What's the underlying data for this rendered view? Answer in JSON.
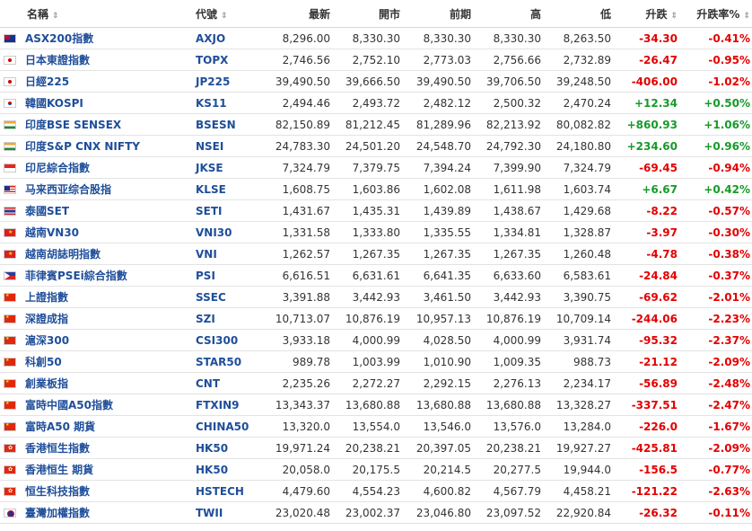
{
  "header": {
    "name": "名稱",
    "code": "代號",
    "last": "最新",
    "open": "開市",
    "prev": "前期",
    "high": "高",
    "low": "低",
    "change": "升跌",
    "change_pct": "升跌率%",
    "sort_glyph": "⇕"
  },
  "colors": {
    "link": "#1f4e9a",
    "down": "#e30000",
    "up": "#189a2a"
  },
  "rows": [
    {
      "flag": "au-flag-icon",
      "name": "ASX200指數",
      "code": "AXJO",
      "last": "8,296.00",
      "open": "8,330.30",
      "prev": "8,330.30",
      "high": "8,330.30",
      "low": "8,263.50",
      "change": "-34.30",
      "pct": "-0.41%",
      "dir": "down"
    },
    {
      "flag": "jp-flag-icon",
      "name": "日本東證指數",
      "code": "TOPX",
      "last": "2,746.56",
      "open": "2,752.10",
      "prev": "2,773.03",
      "high": "2,756.66",
      "low": "2,732.89",
      "change": "-26.47",
      "pct": "-0.95%",
      "dir": "down"
    },
    {
      "flag": "jp-flag-icon",
      "name": "日經225",
      "code": "JP225",
      "last": "39,490.50",
      "open": "39,666.50",
      "prev": "39,490.50",
      "high": "39,706.50",
      "low": "39,248.50",
      "change": "-406.00",
      "pct": "-1.02%",
      "dir": "down"
    },
    {
      "flag": "kr-flag-icon",
      "name": "韓國KOSPI",
      "code": "KS11",
      "last": "2,494.46",
      "open": "2,493.72",
      "prev": "2,482.12",
      "high": "2,500.32",
      "low": "2,470.24",
      "change": "+12.34",
      "pct": "+0.50%",
      "dir": "up"
    },
    {
      "flag": "in-flag-icon",
      "name": "印度BSE SENSEX",
      "code": "BSESN",
      "last": "82,150.89",
      "open": "81,212.45",
      "prev": "81,289.96",
      "high": "82,213.92",
      "low": "80,082.82",
      "change": "+860.93",
      "pct": "+1.06%",
      "dir": "up"
    },
    {
      "flag": "in-flag-icon",
      "name": "印度S&P CNX NIFTY",
      "code": "NSEI",
      "last": "24,783.30",
      "open": "24,501.20",
      "prev": "24,548.70",
      "high": "24,792.30",
      "low": "24,180.80",
      "change": "+234.60",
      "pct": "+0.96%",
      "dir": "up"
    },
    {
      "flag": "id-flag-icon",
      "name": "印尼綜合指數",
      "code": "JKSE",
      "last": "7,324.79",
      "open": "7,379.75",
      "prev": "7,394.24",
      "high": "7,399.90",
      "low": "7,324.79",
      "change": "-69.45",
      "pct": "-0.94%",
      "dir": "down"
    },
    {
      "flag": "my-flag-icon",
      "name": "马来西亚综合股指",
      "code": "KLSE",
      "last": "1,608.75",
      "open": "1,603.86",
      "prev": "1,602.08",
      "high": "1,611.98",
      "low": "1,603.74",
      "change": "+6.67",
      "pct": "+0.42%",
      "dir": "up"
    },
    {
      "flag": "th-flag-icon",
      "name": "泰國SET",
      "code": "SETI",
      "last": "1,431.67",
      "open": "1,435.31",
      "prev": "1,439.89",
      "high": "1,438.67",
      "low": "1,429.68",
      "change": "-8.22",
      "pct": "-0.57%",
      "dir": "down"
    },
    {
      "flag": "vn-flag-icon",
      "name": "越南VN30",
      "code": "VNI30",
      "last": "1,331.58",
      "open": "1,333.80",
      "prev": "1,335.55",
      "high": "1,334.81",
      "low": "1,328.87",
      "change": "-3.97",
      "pct": "-0.30%",
      "dir": "down"
    },
    {
      "flag": "vn-flag-icon",
      "name": "越南胡誌明指數",
      "code": "VNI",
      "last": "1,262.57",
      "open": "1,267.35",
      "prev": "1,267.35",
      "high": "1,267.35",
      "low": "1,260.48",
      "change": "-4.78",
      "pct": "-0.38%",
      "dir": "down"
    },
    {
      "flag": "ph-flag-icon",
      "name": "菲律賓PSEi綜合指數",
      "code": "PSI",
      "last": "6,616.51",
      "open": "6,631.61",
      "prev": "6,641.35",
      "high": "6,633.60",
      "low": "6,583.61",
      "change": "-24.84",
      "pct": "-0.37%",
      "dir": "down"
    },
    {
      "flag": "cn-flag-icon",
      "name": "上證指數",
      "code": "SSEC",
      "last": "3,391.88",
      "open": "3,442.93",
      "prev": "3,461.50",
      "high": "3,442.93",
      "low": "3,390.75",
      "change": "-69.62",
      "pct": "-2.01%",
      "dir": "down"
    },
    {
      "flag": "cn-flag-icon",
      "name": "深證成指",
      "code": "SZI",
      "last": "10,713.07",
      "open": "10,876.19",
      "prev": "10,957.13",
      "high": "10,876.19",
      "low": "10,709.14",
      "change": "-244.06",
      "pct": "-2.23%",
      "dir": "down"
    },
    {
      "flag": "cn-flag-icon",
      "name": "滬深300",
      "code": "CSI300",
      "last": "3,933.18",
      "open": "4,000.99",
      "prev": "4,028.50",
      "high": "4,000.99",
      "low": "3,931.74",
      "change": "-95.32",
      "pct": "-2.37%",
      "dir": "down"
    },
    {
      "flag": "cn-flag-icon",
      "name": "科創50",
      "code": "STAR50",
      "last": "989.78",
      "open": "1,003.99",
      "prev": "1,010.90",
      "high": "1,009.35",
      "low": "988.73",
      "change": "-21.12",
      "pct": "-2.09%",
      "dir": "down"
    },
    {
      "flag": "cn-flag-icon",
      "name": "創業板指",
      "code": "CNT",
      "last": "2,235.26",
      "open": "2,272.27",
      "prev": "2,292.15",
      "high": "2,276.13",
      "low": "2,234.17",
      "change": "-56.89",
      "pct": "-2.48%",
      "dir": "down"
    },
    {
      "flag": "cn-flag-icon",
      "name": "富時中國A50指數",
      "code": "FTXIN9",
      "last": "13,343.37",
      "open": "13,680.88",
      "prev": "13,680.88",
      "high": "13,680.88",
      "low": "13,328.27",
      "change": "-337.51",
      "pct": "-2.47%",
      "dir": "down"
    },
    {
      "flag": "cn-flag-icon",
      "name": "富時A50 期貨",
      "code": "CHINA50",
      "last": "13,320.0",
      "open": "13,554.0",
      "prev": "13,546.0",
      "high": "13,576.0",
      "low": "13,284.0",
      "change": "-226.0",
      "pct": "-1.67%",
      "dir": "down"
    },
    {
      "flag": "hk-flag-icon",
      "name": "香港恒生指數",
      "code": "HK50",
      "last": "19,971.24",
      "open": "20,238.21",
      "prev": "20,397.05",
      "high": "20,238.21",
      "low": "19,927.27",
      "change": "-425.81",
      "pct": "-2.09%",
      "dir": "down"
    },
    {
      "flag": "hk-flag-icon",
      "name": "香港恒生 期貨",
      "code": "HK50",
      "last": "20,058.0",
      "open": "20,175.5",
      "prev": "20,214.5",
      "high": "20,277.5",
      "low": "19,944.0",
      "change": "-156.5",
      "pct": "-0.77%",
      "dir": "down"
    },
    {
      "flag": "hk-flag-icon",
      "name": "恒生科技指數",
      "code": "HSTECH",
      "last": "4,479.60",
      "open": "4,554.23",
      "prev": "4,600.82",
      "high": "4,567.79",
      "low": "4,458.21",
      "change": "-121.22",
      "pct": "-2.63%",
      "dir": "down"
    },
    {
      "flag": "tw-flag-icon",
      "name": "臺灣加權指數",
      "code": "TWII",
      "last": "23,020.48",
      "open": "23,002.37",
      "prev": "23,046.80",
      "high": "23,097.52",
      "low": "22,920.84",
      "change": "-26.32",
      "pct": "-0.11%",
      "dir": "down"
    }
  ]
}
